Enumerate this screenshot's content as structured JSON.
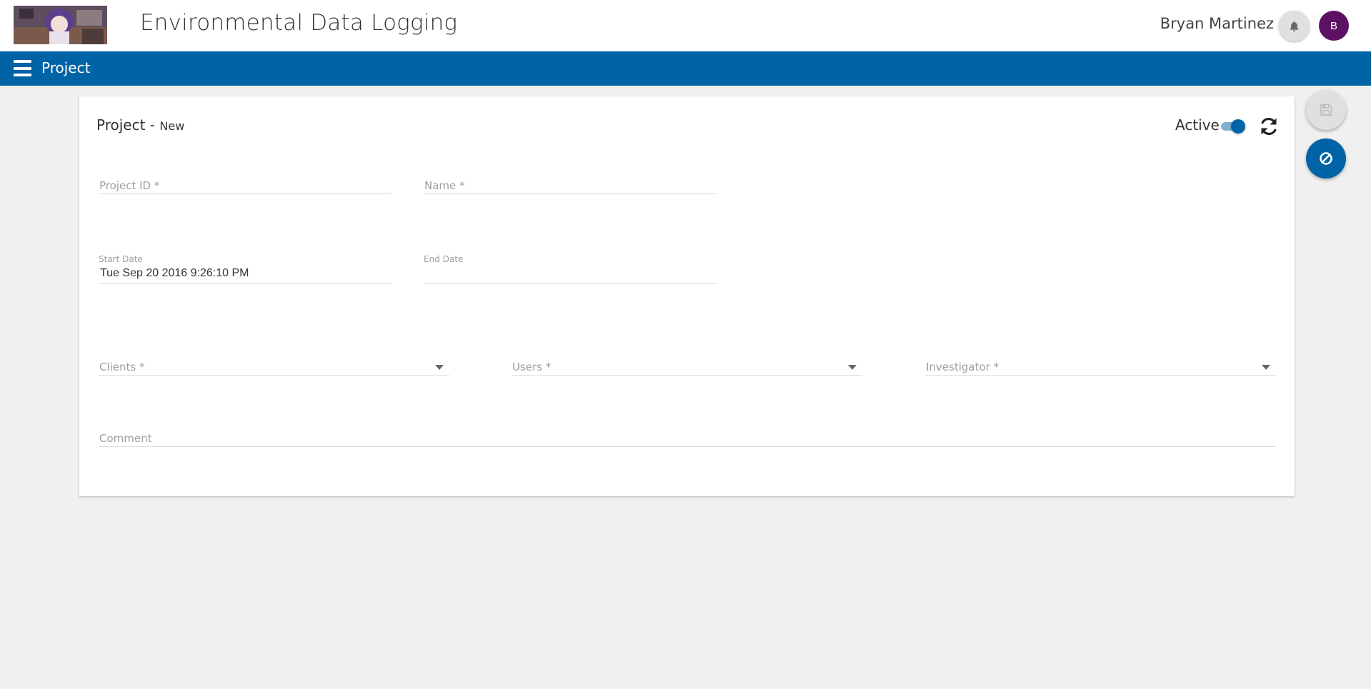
{
  "header": {
    "app_title": "Environmental Data Logging",
    "user_name": "Bryan Martinez",
    "avatar_initial": "B"
  },
  "nav": {
    "title": "Project"
  },
  "card": {
    "title": "Project -",
    "subtitle": "New",
    "active_label": "Active",
    "active": true
  },
  "form": {
    "project_id": {
      "placeholder": "Project ID *",
      "value": ""
    },
    "name": {
      "placeholder": "Name *",
      "value": ""
    },
    "start_date": {
      "label": "Start Date",
      "value": "Tue Sep 20 2016 9:26:10 PM"
    },
    "end_date": {
      "label": "End Date",
      "value": ""
    },
    "clients": {
      "placeholder": "Clients *"
    },
    "users": {
      "placeholder": "Users *"
    },
    "investigator": {
      "placeholder": "Investigator *"
    },
    "comment": {
      "placeholder": "Comment"
    }
  },
  "icons": {
    "menu": "menu-icon",
    "bell": "bell-icon",
    "refresh": "refresh-icon",
    "save": "save-icon",
    "cancel": "cancel-icon"
  },
  "colors": {
    "primary": "#0063a6",
    "avatar": "#5c1163",
    "background": "#f0f0f0"
  }
}
